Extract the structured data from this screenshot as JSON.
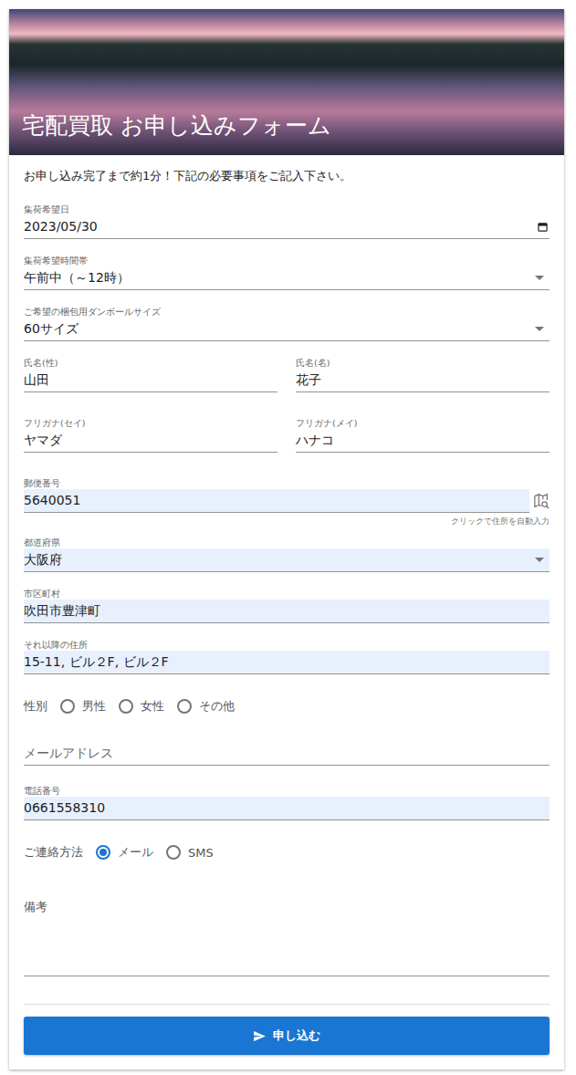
{
  "header": {
    "title": "宅配買取 お申し込みフォーム"
  },
  "intro": "お申し込み完了まで約1分！下記の必要事項をご記入下さい。",
  "items": [
    {
      "kind": "date",
      "label": "集荷希望日",
      "value": "2023/05/30",
      "autofilled": false
    },
    {
      "kind": "select",
      "label": "集荷希望時間帯",
      "value": "午前中（～12時）",
      "autofilled": false
    },
    {
      "kind": "select",
      "label": "ご希望の梱包用ダンボールサイズ",
      "value": "60サイズ",
      "autofilled": false
    },
    {
      "kind": "pair",
      "fields": [
        {
          "label": "氏名(性)",
          "value": "山田"
        },
        {
          "label": "氏名(名)",
          "value": "花子"
        }
      ]
    },
    {
      "kind": "pair",
      "fields": [
        {
          "label": "フリガナ(セイ)",
          "value": "ヤマダ"
        },
        {
          "label": "フリガナ(メイ)",
          "value": "ハナコ"
        }
      ]
    },
    {
      "kind": "postal",
      "label": "郵便番号",
      "value": "5640051",
      "helper": "クリックで住所を自動入力",
      "autofilled": true
    },
    {
      "kind": "select",
      "label": "都道府県",
      "value": "大阪府",
      "autofilled": true
    },
    {
      "kind": "text",
      "label": "市区町村",
      "value": "吹田市豊津町",
      "autofilled": true
    },
    {
      "kind": "text",
      "label": "それ以降の住所",
      "value": "15-11, ビル２F, ビル２F",
      "autofilled": true
    },
    {
      "kind": "radio",
      "label": "性別",
      "options": [
        {
          "label": "男性",
          "selected": false
        },
        {
          "label": "女性",
          "selected": false
        },
        {
          "label": "その他",
          "selected": false
        }
      ]
    },
    {
      "kind": "placeholder",
      "placeholder": "メールアドレス"
    },
    {
      "kind": "text",
      "label": "電話番号",
      "value": "0661558310",
      "autofilled": true
    },
    {
      "kind": "radio",
      "label": "ご連絡方法",
      "options": [
        {
          "label": "メール",
          "selected": true
        },
        {
          "label": "SMS",
          "selected": false
        }
      ]
    },
    {
      "kind": "textarea",
      "label": "備考"
    }
  ],
  "submit": {
    "label": "申し込む"
  }
}
